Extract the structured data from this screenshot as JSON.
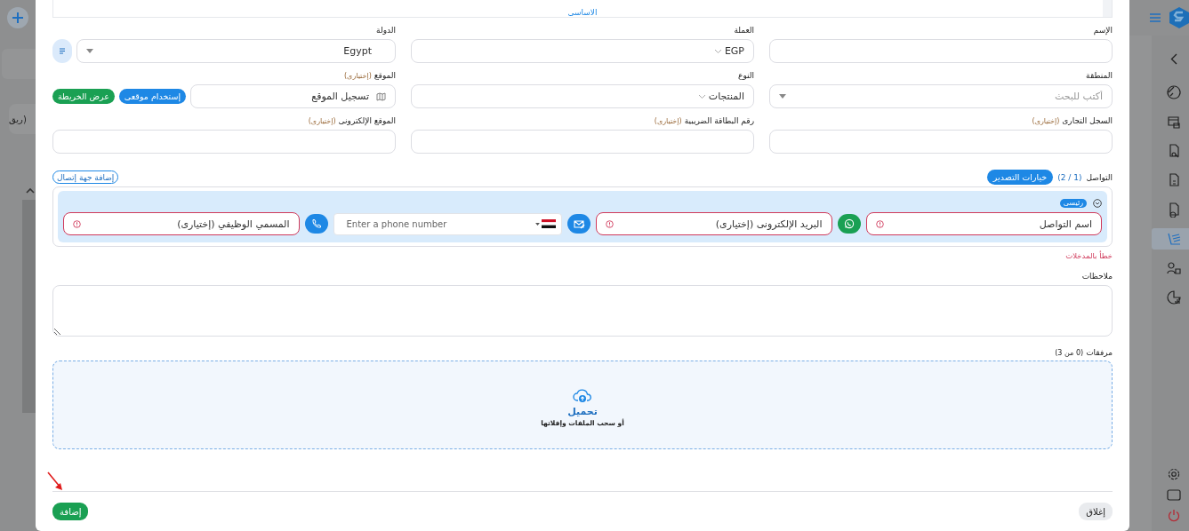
{
  "background": {
    "text": "ريق)"
  },
  "section_tab": {
    "label": "الاساسى"
  },
  "fields": [
    {
      "kind": "text",
      "label": "الإسم"
    },
    {
      "kind": "select",
      "label": "العملة",
      "value": "EGP"
    },
    {
      "kind": "dropdown",
      "label": "الدولة",
      "value": "Egypt"
    },
    {
      "kind": "search",
      "label": "المنطقة",
      "placeholder": "أكتب للبحث"
    },
    {
      "kind": "select",
      "label": "النوع",
      "value": "المنتجات"
    },
    {
      "kind": "location",
      "label": "الموقع",
      "optional": "(إختيارى)",
      "value": "تسجيل الموقع",
      "actions": [
        {
          "label": "إستخدام موقعى",
          "color": "#1e88e5"
        },
        {
          "label": "عرض الخريطة",
          "color": "#1aa053"
        }
      ]
    },
    {
      "kind": "text",
      "label": "السجل التجارى",
      "optional": "(إختيارى)"
    },
    {
      "kind": "text",
      "label": "رقم البطاقة الضريبية",
      "optional": "(إختيارى)"
    },
    {
      "kind": "text",
      "label": "الموقع الإلكترونى",
      "optional": "(إختيارى)"
    }
  ],
  "contacts": {
    "title": "التواصل",
    "count": "(1 / 2)",
    "export_button": "خيارات التصدير",
    "add_button": "إضافة جهة إتصال",
    "items": [
      {
        "badge": "رئيسى",
        "expanded": true,
        "controls": [
          {
            "kind": "input",
            "placeholder": "اسم التواصل",
            "error": true
          },
          {
            "kind": "whatsapp"
          },
          {
            "kind": "input",
            "placeholder": "البريد الإلكترونى (إختيارى)",
            "error": true
          },
          {
            "kind": "mail"
          },
          {
            "kind": "phone",
            "placeholder": "Enter a phone number"
          },
          {
            "kind": "call"
          },
          {
            "kind": "input",
            "placeholder": "المسمي الوظيفي (إختيارى)",
            "error": true
          }
        ]
      }
    ],
    "error_text": "خطأ بالمدخلات"
  },
  "notes": {
    "label": "ملاحظات"
  },
  "attachments": {
    "label": "مرفقات",
    "count": "(0 من 3)",
    "upload": "تحميل",
    "hint": "أو سحب الملفات وإفلاتها"
  },
  "footer": {
    "submit": "إضافة",
    "close": "إغلاق"
  },
  "sidebar": {
    "items": [
      {
        "selected": false
      },
      {
        "selected": false
      },
      {
        "selected": false
      },
      {
        "selected": false
      },
      {
        "selected": false
      },
      {
        "selected": true
      },
      {
        "selected": false
      },
      {
        "selected": false
      }
    ]
  }
}
